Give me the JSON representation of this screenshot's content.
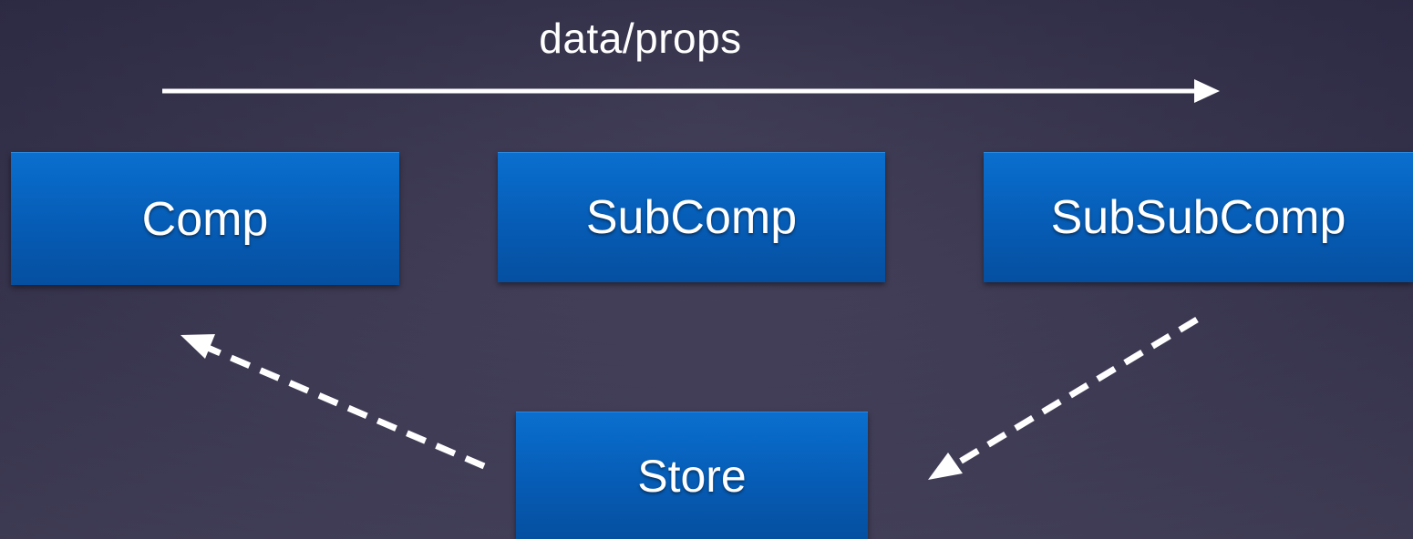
{
  "diagram": {
    "flow_label": "data/props",
    "nodes": {
      "comp": "Comp",
      "subcomp": "SubComp",
      "subsubcomp": "SubSubComp",
      "store": "Store"
    },
    "edges": [
      {
        "from": "Comp",
        "to": "SubSubComp",
        "style": "solid",
        "meaning": "data/props"
      },
      {
        "from": "SubSubComp",
        "to": "Store",
        "style": "dashed"
      },
      {
        "from": "Store",
        "to": "Comp",
        "style": "dashed"
      }
    ]
  },
  "colors": {
    "box": "#065cb5",
    "arrow": "#ffffff",
    "background": "#3f3b55"
  }
}
